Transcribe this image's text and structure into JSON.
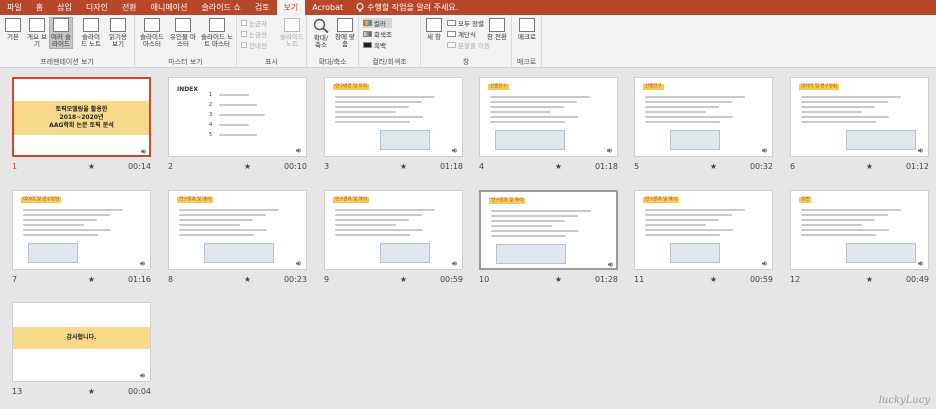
{
  "tabs": [
    "파일",
    "홈",
    "삽입",
    "디자인",
    "전환",
    "애니메이션",
    "슬라이드 쇼",
    "검토",
    "보기",
    "Acrobat"
  ],
  "active_tab": "보기",
  "tell_me": "수행할 작업을 알려 주세요.",
  "ribbon": {
    "presentation_views": {
      "label": "프레젠테이션 보기",
      "buttons": [
        "기본",
        "개요 보기",
        "여러 슬라이드",
        "슬라이드 노트",
        "읽기용 보기"
      ]
    },
    "master_views": {
      "label": "마스터 보기",
      "buttons": [
        "슬라이드 마스터",
        "유인물 마스터",
        "슬라이드 노트 마스터"
      ]
    },
    "show": {
      "label": "표시",
      "items": [
        "눈금자",
        "눈금선",
        "안내선"
      ],
      "notes_button": "슬라이드 노트"
    },
    "zoom": {
      "label": "확대/축소",
      "buttons": [
        "확대/ 축소",
        "창에 맞춤"
      ]
    },
    "color": {
      "label": "컬러/회색조",
      "items": [
        "컬러",
        "회색조",
        "흑백"
      ]
    },
    "window": {
      "label": "창",
      "new_window": "새 창",
      "items": [
        "모두 정렬",
        "계단식",
        "분할줄 이동"
      ],
      "switch": "창 전환"
    },
    "macro": {
      "label": "매크로",
      "button": "매크로"
    }
  },
  "slides": [
    {
      "num": "1",
      "dur": "00:14",
      "type": "title",
      "title": "토픽모델링을 활용한\n2018~2020년\nAAG학회 논문 토픽 분석"
    },
    {
      "num": "2",
      "dur": "00:10",
      "type": "index",
      "heading": "INDEX",
      "items": [
        "1",
        "2",
        "3",
        "4",
        "5"
      ]
    },
    {
      "num": "3",
      "dur": "01:18",
      "type": "content",
      "head": "연구배경 및 목적"
    },
    {
      "num": "4",
      "dur": "01:18",
      "type": "content",
      "head": "선행연구"
    },
    {
      "num": "5",
      "dur": "00:32",
      "type": "content",
      "head": "선행연구"
    },
    {
      "num": "6",
      "dur": "01:12",
      "type": "content",
      "head": "데이터 및 연구방법"
    },
    {
      "num": "7",
      "dur": "01:16",
      "type": "content",
      "head": "데이터 및 연구방법"
    },
    {
      "num": "8",
      "dur": "00:23",
      "type": "content",
      "head": "연구결과 및 해석"
    },
    {
      "num": "9",
      "dur": "00:59",
      "type": "content",
      "head": "연구결과 및 해석"
    },
    {
      "num": "10",
      "dur": "01:28",
      "type": "content",
      "head": "연구결과 및 해석"
    },
    {
      "num": "11",
      "dur": "00:59",
      "type": "content",
      "head": "연구결과 및 해석"
    },
    {
      "num": "12",
      "dur": "00:49",
      "type": "content",
      "head": "결론"
    },
    {
      "num": "13",
      "dur": "00:04",
      "type": "end",
      "title": "감사합니다."
    }
  ],
  "watermark": "luckyLucy",
  "colors": {
    "tabbar": "#b7472a",
    "selection": "#d24726",
    "title_band": "#f7d98b"
  }
}
